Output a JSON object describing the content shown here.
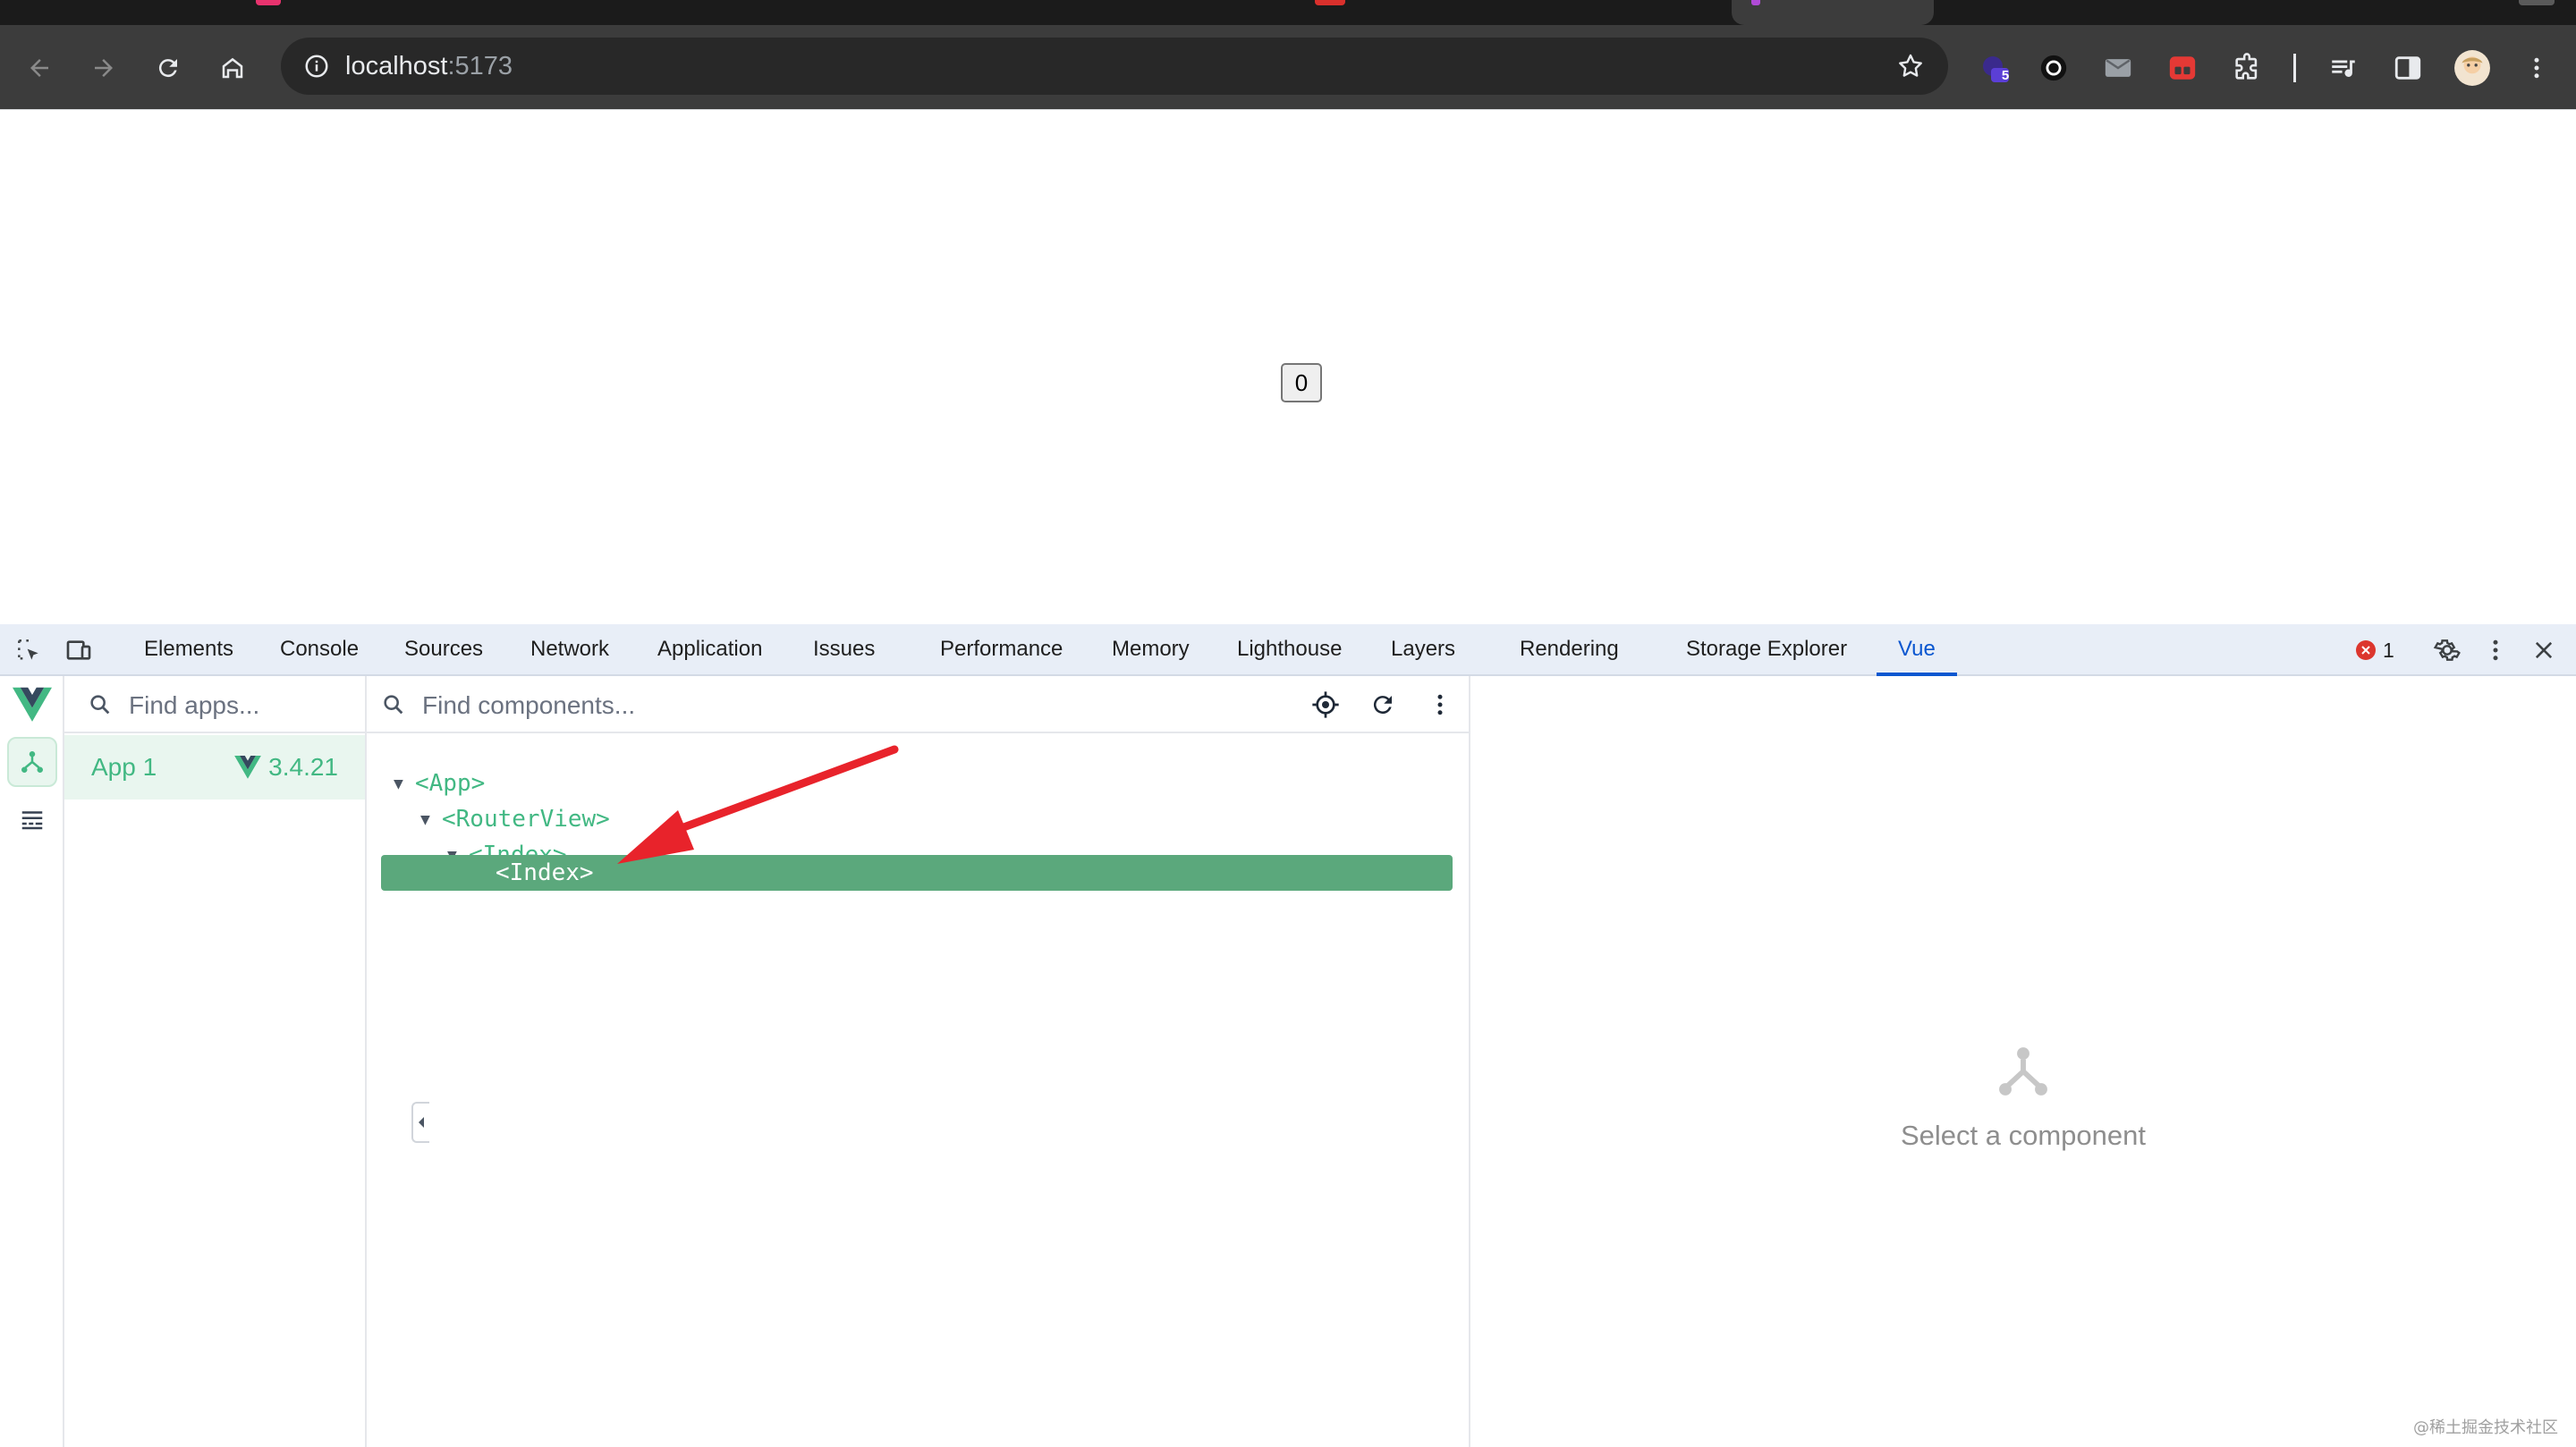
{
  "browser": {
    "url_host": "localhost",
    "url_port": ":5173",
    "extension_badge": "5"
  },
  "page": {
    "counter_value": "0"
  },
  "devtools": {
    "tabs": [
      "Elements",
      "Console",
      "Sources",
      "Network",
      "Application",
      "Issues",
      "Performance",
      "Memory",
      "Lighthouse",
      "Layers",
      "Rendering",
      "Storage Explorer",
      "Vue"
    ],
    "active_tab": "Vue",
    "error_count": "1"
  },
  "vue": {
    "apps_search_placeholder": "Find apps...",
    "components_search_placeholder": "Find components...",
    "app": {
      "name": "App 1",
      "version": "3.4.21"
    },
    "tree": [
      {
        "label": "<App>"
      },
      {
        "label": "<RouterView>"
      },
      {
        "label": "<Index>"
      },
      {
        "label": "<Index>",
        "selected": true
      }
    ],
    "empty_state": "Select a component"
  },
  "watermark": "@稀土掘金技术社区",
  "colors": {
    "vue_green": "#42b883",
    "selected_row": "#5ba87c",
    "active_tab": "#0b57d0",
    "annotation_arrow": "#e8232b"
  }
}
